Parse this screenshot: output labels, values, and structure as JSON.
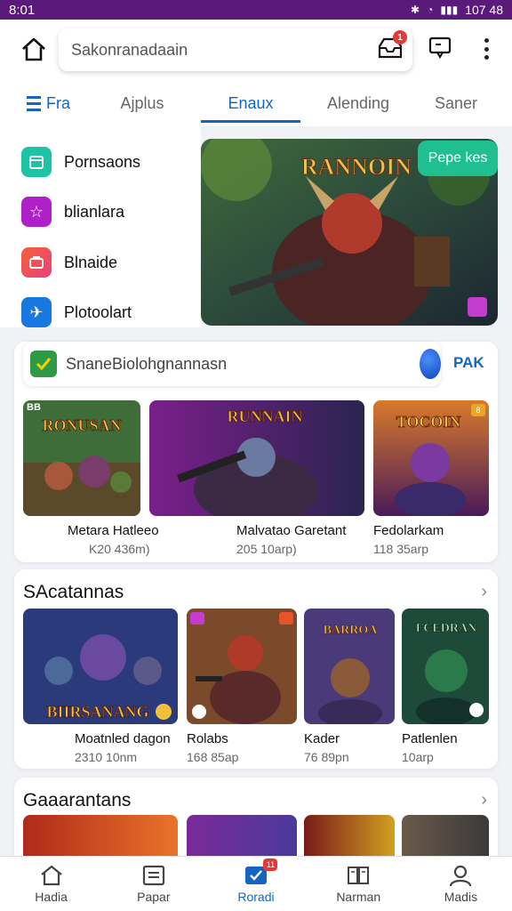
{
  "status": {
    "time": "8:01",
    "right": "107 48"
  },
  "search": {
    "placeholder": "Sakonranadaain"
  },
  "inbox": {
    "badge": "1"
  },
  "tabs": [
    {
      "label": "Fra"
    },
    {
      "label": "Ajplus"
    },
    {
      "label": "Enaux"
    },
    {
      "label": "Alending"
    },
    {
      "label": "Saner"
    }
  ],
  "menu": [
    {
      "label": "Pornsaons",
      "icon": "calendar-icon",
      "color": "#1ec3a5"
    },
    {
      "label": "blianlara",
      "icon": "star-icon",
      "color": "#b020c8"
    },
    {
      "label": "Blnaide",
      "icon": "briefcase-icon",
      "color": "#f4603b"
    },
    {
      "label": "Plotoolart",
      "icon": "plane-icon",
      "color": "#1977e0"
    }
  ],
  "banner": {
    "title": "RANNOIN",
    "button": "Pepe kes"
  },
  "inner_search": {
    "text": "SnaneBiolohgnannasn",
    "action": "PAK"
  },
  "row1": [
    {
      "title": "Metara Hatleeo",
      "sub": "K20 436m)",
      "art": "RONUSAN",
      "tag": "BB"
    },
    {
      "title": "Malvatao Garetant",
      "sub": "205 10arp)",
      "art": "RUNNAIN",
      "tag": ""
    },
    {
      "title": "Fedolarkam",
      "sub": "118 35arp",
      "art": "TOCOIN",
      "tag": "8"
    }
  ],
  "section2": {
    "title": "SAcatannas",
    "cards": [
      {
        "title": "Moatnled dagon",
        "sub": "2310 10nm",
        "art": "BIIRSANANG"
      },
      {
        "title": "Rolabs",
        "sub": "168 85ap",
        "art": ""
      },
      {
        "title": "Kader",
        "sub": "76 89pn",
        "art": "BARROA"
      },
      {
        "title": "Patlenlen",
        "sub": "10arp",
        "art": "FCEDRAN"
      }
    ]
  },
  "section3": {
    "title": "Gaaarantans"
  },
  "nav": [
    {
      "label": "Hadia",
      "icon": "home-icon"
    },
    {
      "label": "Papar",
      "icon": "document-icon"
    },
    {
      "label": "Roradi",
      "icon": "check-icon",
      "badge": "11"
    },
    {
      "label": "Narman",
      "icon": "book-icon"
    },
    {
      "label": "Madis",
      "icon": "person-icon"
    }
  ]
}
